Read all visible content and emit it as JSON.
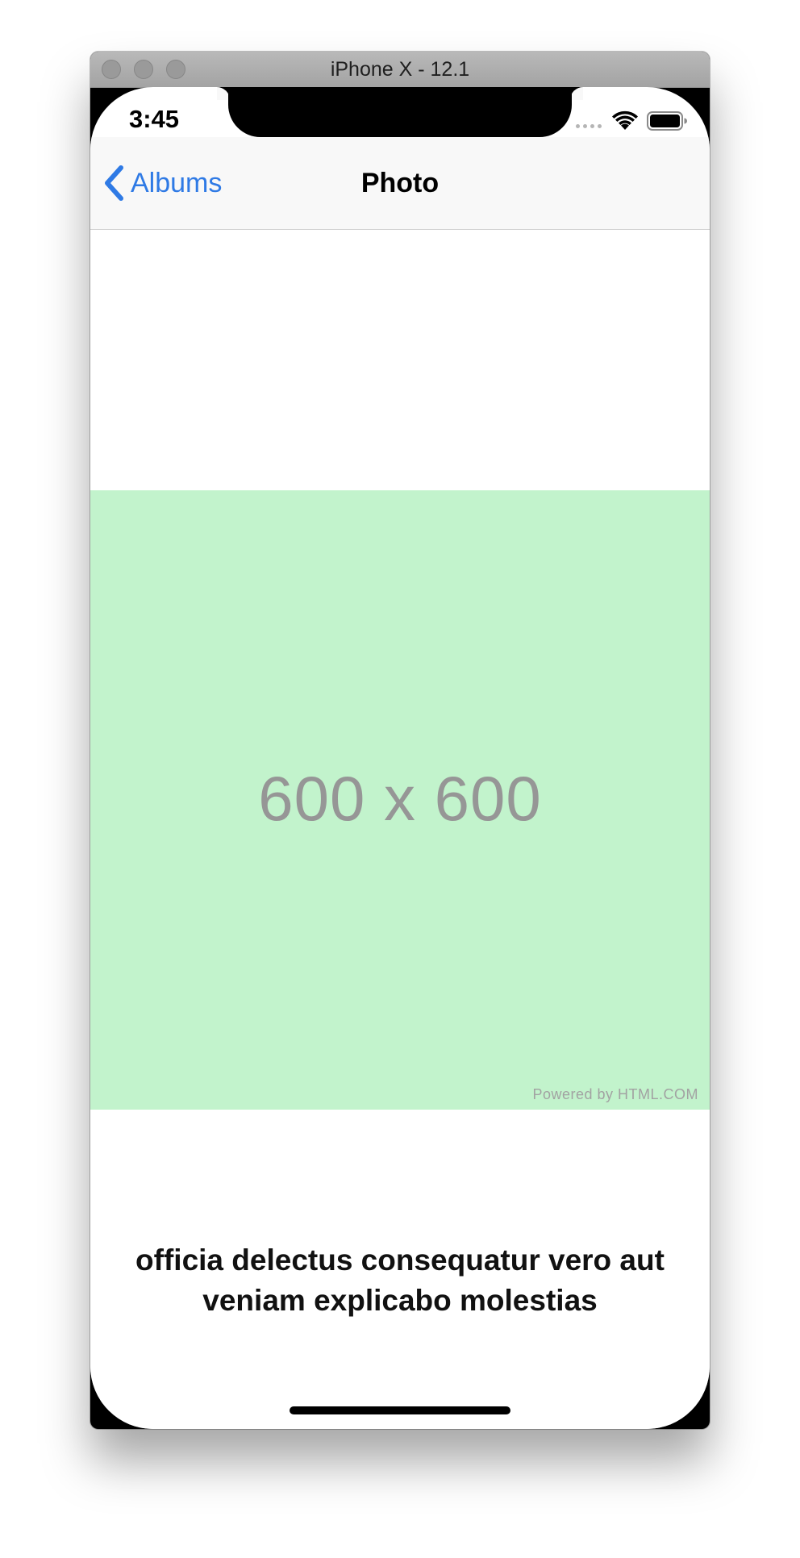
{
  "window": {
    "title": "iPhone X - 12.1"
  },
  "status_bar": {
    "time": "3:45"
  },
  "nav_bar": {
    "back_label": "Albums",
    "title": "Photo"
  },
  "photo": {
    "placeholder_text": "600 x 600",
    "credit": "Powered by HTML.COM",
    "background_color": "#c2f3cc"
  },
  "caption": {
    "text": "officia delectus consequatur vero aut veniam explicabo molestias"
  },
  "colors": {
    "accent": "#2f7ae5"
  }
}
